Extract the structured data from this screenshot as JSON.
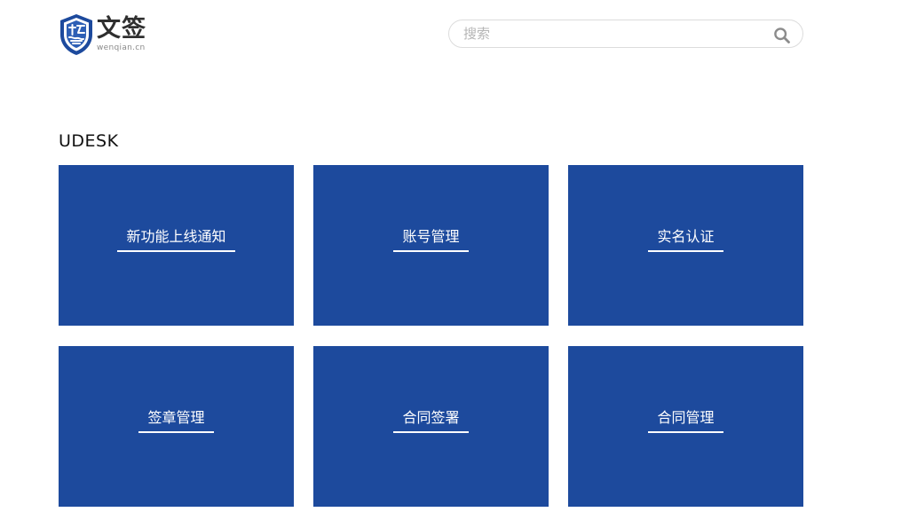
{
  "header": {
    "logo": {
      "name": "文签",
      "domain": "wenqian.cn",
      "brand_color": "#1d4a9d"
    },
    "search": {
      "placeholder": "搜索",
      "value": "",
      "icon": "search-icon"
    }
  },
  "section": {
    "title": "UDESK",
    "cards": [
      {
        "label": "新功能上线通知"
      },
      {
        "label": "账号管理"
      },
      {
        "label": "实名认证"
      },
      {
        "label": "签章管理"
      },
      {
        "label": "合同签署"
      },
      {
        "label": "合同管理"
      }
    ],
    "card_color": "#1d4a9d"
  }
}
